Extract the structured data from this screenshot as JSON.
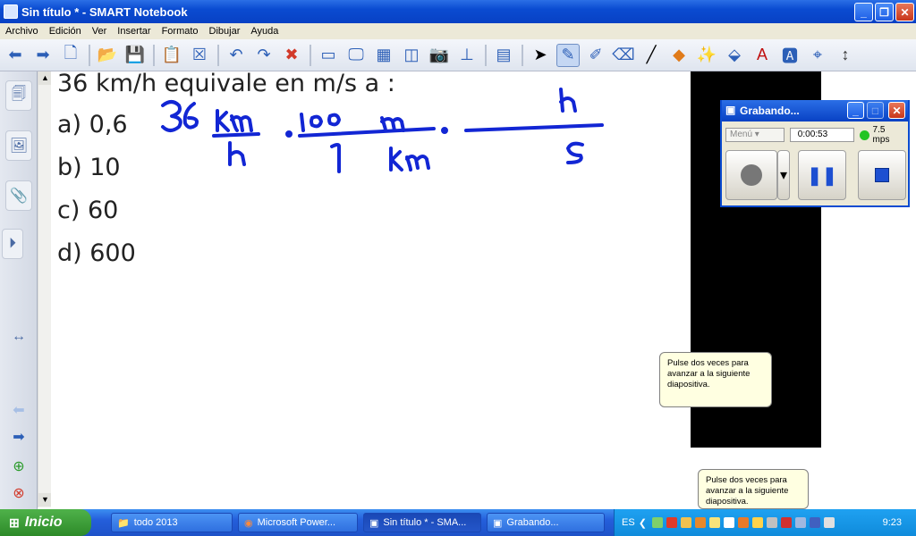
{
  "window": {
    "title": "Sin título * - SMART Notebook"
  },
  "menu": [
    "Archivo",
    "Edición",
    "Ver",
    "Insertar",
    "Formato",
    "Dibujar",
    "Ayuda"
  ],
  "question": {
    "text": "36 km/h equivale en m/s a :",
    "options": [
      "a)  0,6",
      "b)  10",
      "c)  60",
      "d)  600"
    ]
  },
  "recorder": {
    "title": "Grabando...",
    "menu_label": "Menú",
    "time": "0:00:53",
    "rate": "7.5 mps"
  },
  "tooltip": "Pulse dos veces para avanzar a la siguiente diapositiva.",
  "taskbar": {
    "start": "Inicio",
    "tasks": [
      "todo 2013",
      "Microsoft Power...",
      "Sin título * - SMA...",
      "Grabando..."
    ],
    "lang": "ES",
    "clock": "9:23"
  }
}
